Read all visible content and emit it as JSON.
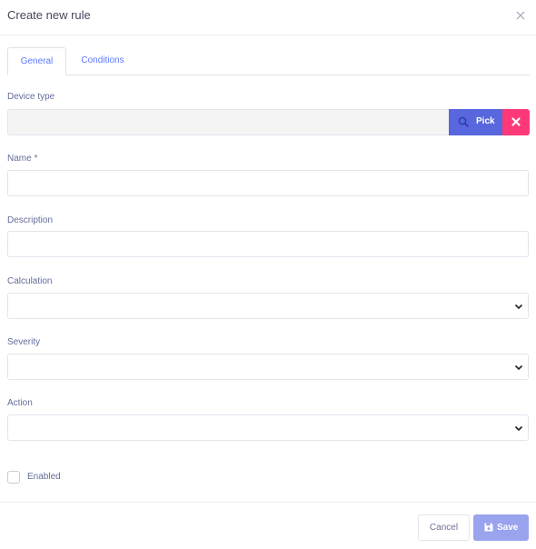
{
  "modal": {
    "title": "Create new rule"
  },
  "tabs": [
    {
      "label": "General",
      "active": true
    },
    {
      "label": "Conditions",
      "active": false
    }
  ],
  "form": {
    "device_type": {
      "label": "Device type",
      "value": ""
    },
    "pick_button": {
      "label": "Pick",
      "icon": "search-icon"
    },
    "clear_button": {
      "icon": "close-icon"
    },
    "name": {
      "label": "Name *",
      "value": ""
    },
    "description": {
      "label": "Description",
      "value": ""
    },
    "calculation": {
      "label": "Calculation",
      "value": ""
    },
    "severity": {
      "label": "Severity",
      "value": ""
    },
    "action": {
      "label": "Action",
      "value": ""
    },
    "enabled": {
      "label": "Enabled",
      "checked": false
    }
  },
  "footer": {
    "cancel_label": "Cancel",
    "save_label": "Save",
    "save_icon": "floppy-disk-icon"
  },
  "colors": {
    "accent": "#5d78ff",
    "pick": "#5867dd",
    "clear": "#fd397a",
    "save": "#9aa3ee"
  }
}
